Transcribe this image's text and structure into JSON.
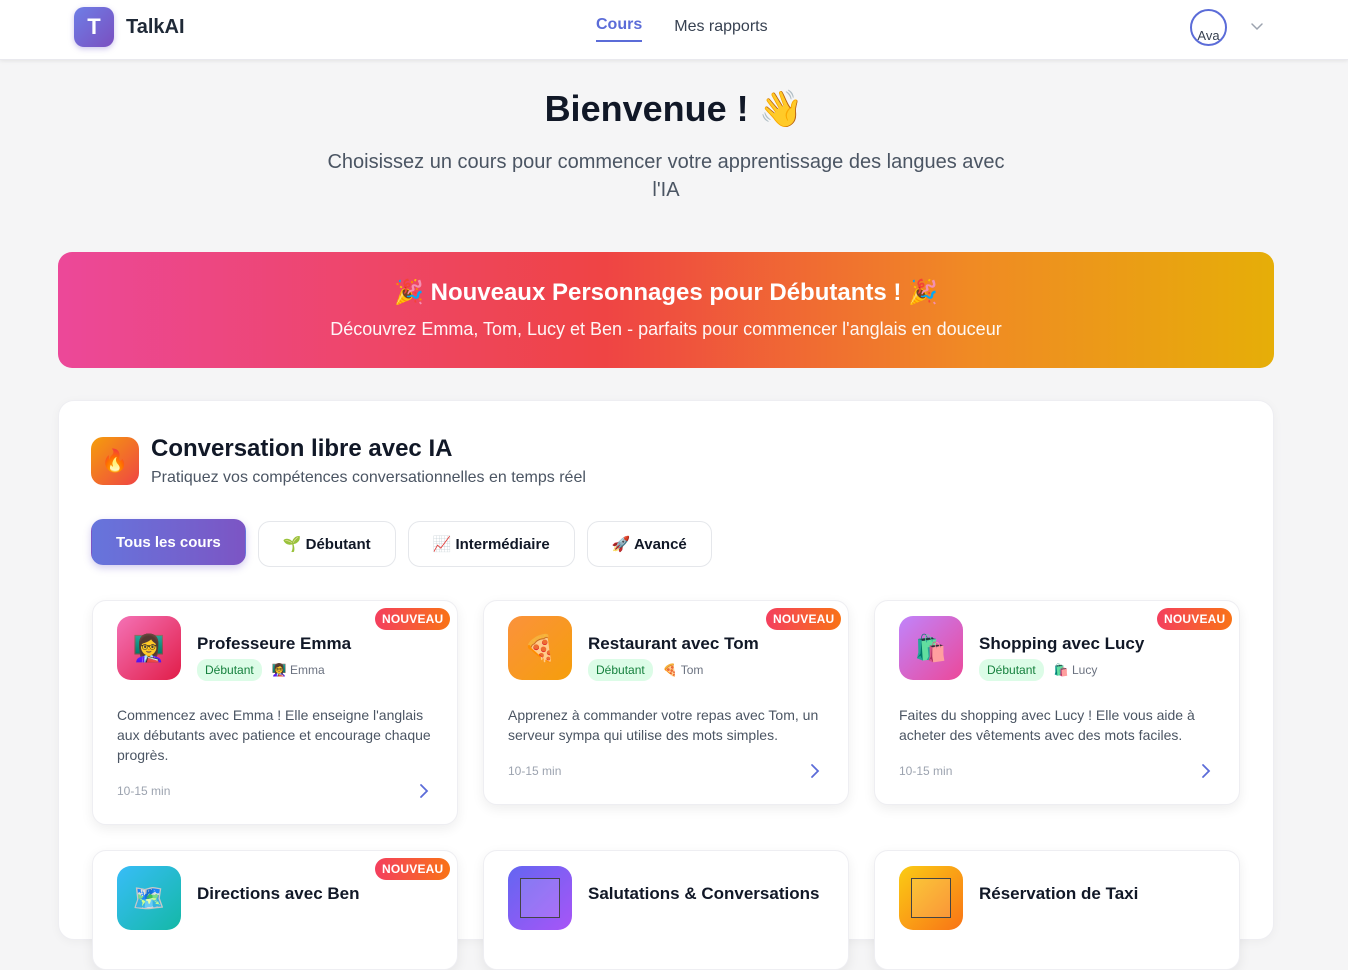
{
  "header": {
    "logo_letter": "T",
    "brand": "TalkAI",
    "nav": [
      "Cours",
      "Mes rapports"
    ],
    "avatar_alt": "Ava"
  },
  "hero": {
    "title": "Bienvenue ! 👋",
    "subtitle": "Choisissez un cours pour commencer votre apprentissage des langues avec l'IA"
  },
  "banner": {
    "title": "🎉 Nouveaux Personnages pour Débutants ! 🎉",
    "text": "Découvrez Emma, Tom, Lucy et Ben - parfaits pour commencer l'anglais en douceur"
  },
  "section": {
    "icon": "🔥",
    "title": "Conversation libre avec IA",
    "subtitle": "Pratiquez vos compétences conversationnelles en temps réel",
    "filters": [
      "Tous les cours",
      "🌱 Débutant",
      "📈 Intermédiaire",
      "🚀 Avancé"
    ]
  },
  "courses": [
    {
      "icon": "👩‍🏫",
      "title": "Professeure Emma",
      "badge": "NOUVEAU",
      "level": "Débutant",
      "character": "👩‍🏫 Emma",
      "description": "Commencez avec Emma ! Elle enseigne l'anglais aux débutants avec patience et encourage chaque progrès.",
      "duration": "10-15 min"
    },
    {
      "icon": "🍕",
      "title": "Restaurant avec Tom",
      "badge": "NOUVEAU",
      "level": "Débutant",
      "character": "🍕 Tom",
      "description": "Apprenez à commander votre repas avec Tom, un serveur sympa qui utilise des mots simples.",
      "duration": "10-15 min"
    },
    {
      "icon": "🛍️",
      "title": "Shopping avec Lucy",
      "badge": "NOUVEAU",
      "level": "Débutant",
      "character": "🛍️ Lucy",
      "description": "Faites du shopping avec Lucy ! Elle vous aide à acheter des vêtements avec des mots faciles.",
      "duration": "10-15 min"
    },
    {
      "icon": "🗺️",
      "title": "Directions avec Ben",
      "badge": "NOUVEAU"
    },
    {
      "title": "Salutations & Conversations"
    },
    {
      "title": "Réservation de Taxi"
    }
  ],
  "colors": {
    "accent": "#5b6cd8",
    "banner_start": "#ec4899",
    "banner_end": "#e6ae08",
    "badge": "#f43f5e",
    "level_bg": "#dcfce7"
  }
}
